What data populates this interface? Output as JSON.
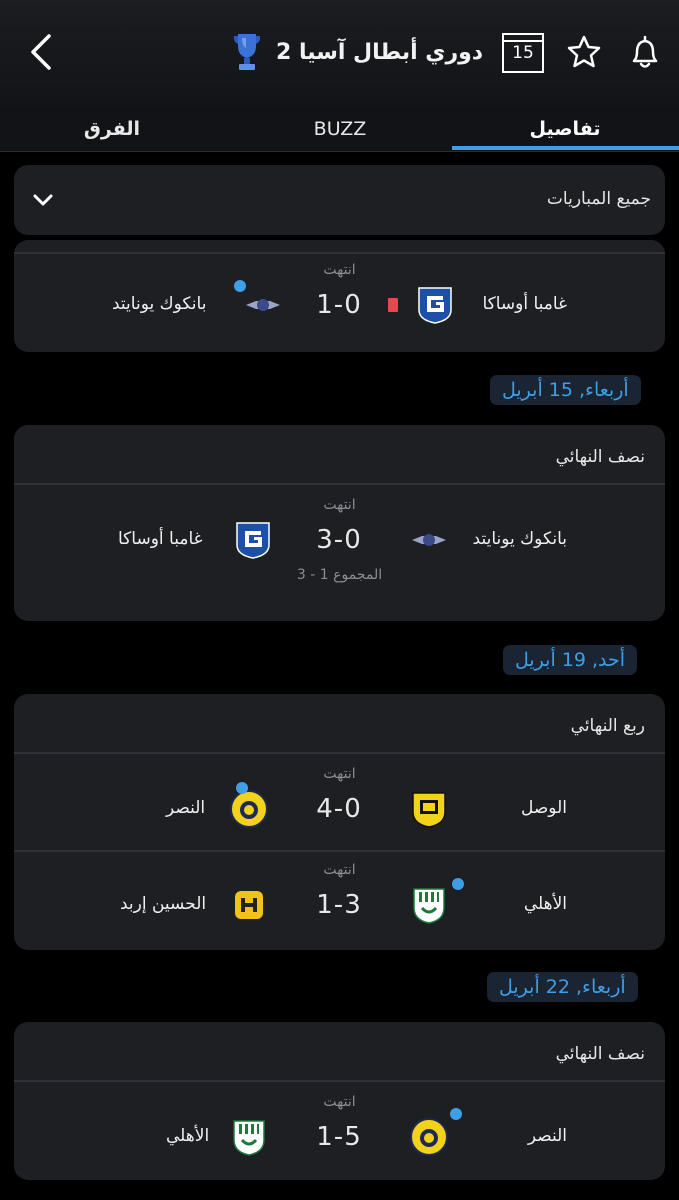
{
  "header": {
    "title": "دوري أبطال آسيا 2",
    "calendar_day": "15"
  },
  "tabs": [
    {
      "label": "تفاصيل",
      "active": true
    },
    {
      "label": "BUZZ",
      "active": false
    },
    {
      "label": "الفرق",
      "active": false
    }
  ],
  "filter": {
    "label": "جميع المباريات"
  },
  "top_match": {
    "status": "انتهت",
    "home": "غامبا أوساكا",
    "away": "بانكوك يونايتد",
    "score": "1-0"
  },
  "groups": [
    {
      "date": "أربعاء, 15 أبريل",
      "round": "نصف النهائي",
      "matches": [
        {
          "status": "انتهت",
          "home": "بانكوك يونايتد",
          "away": "غامبا أوساكا",
          "score": "3-0",
          "aggregate": "المجموع 1 - 3"
        }
      ]
    },
    {
      "date": "أحد, 19 أبريل",
      "round": "ربع النهائي",
      "matches": [
        {
          "status": "انتهت",
          "home": "الوصل",
          "away": "النصر",
          "score": "4-0"
        },
        {
          "status": "انتهت",
          "home": "الأهلي",
          "away": "الحسين إربد",
          "score": "1-3"
        }
      ]
    },
    {
      "date": "أربعاء, 22 أبريل",
      "round": "نصف النهائي",
      "matches": [
        {
          "status": "انتهت",
          "home": "النصر",
          "away": "الأهلي",
          "score": "1-5"
        }
      ]
    }
  ],
  "colors": {
    "accent": "#3e9ee6",
    "card": "#1d1f23",
    "background": "#000000",
    "red_card": "#e5484d"
  }
}
